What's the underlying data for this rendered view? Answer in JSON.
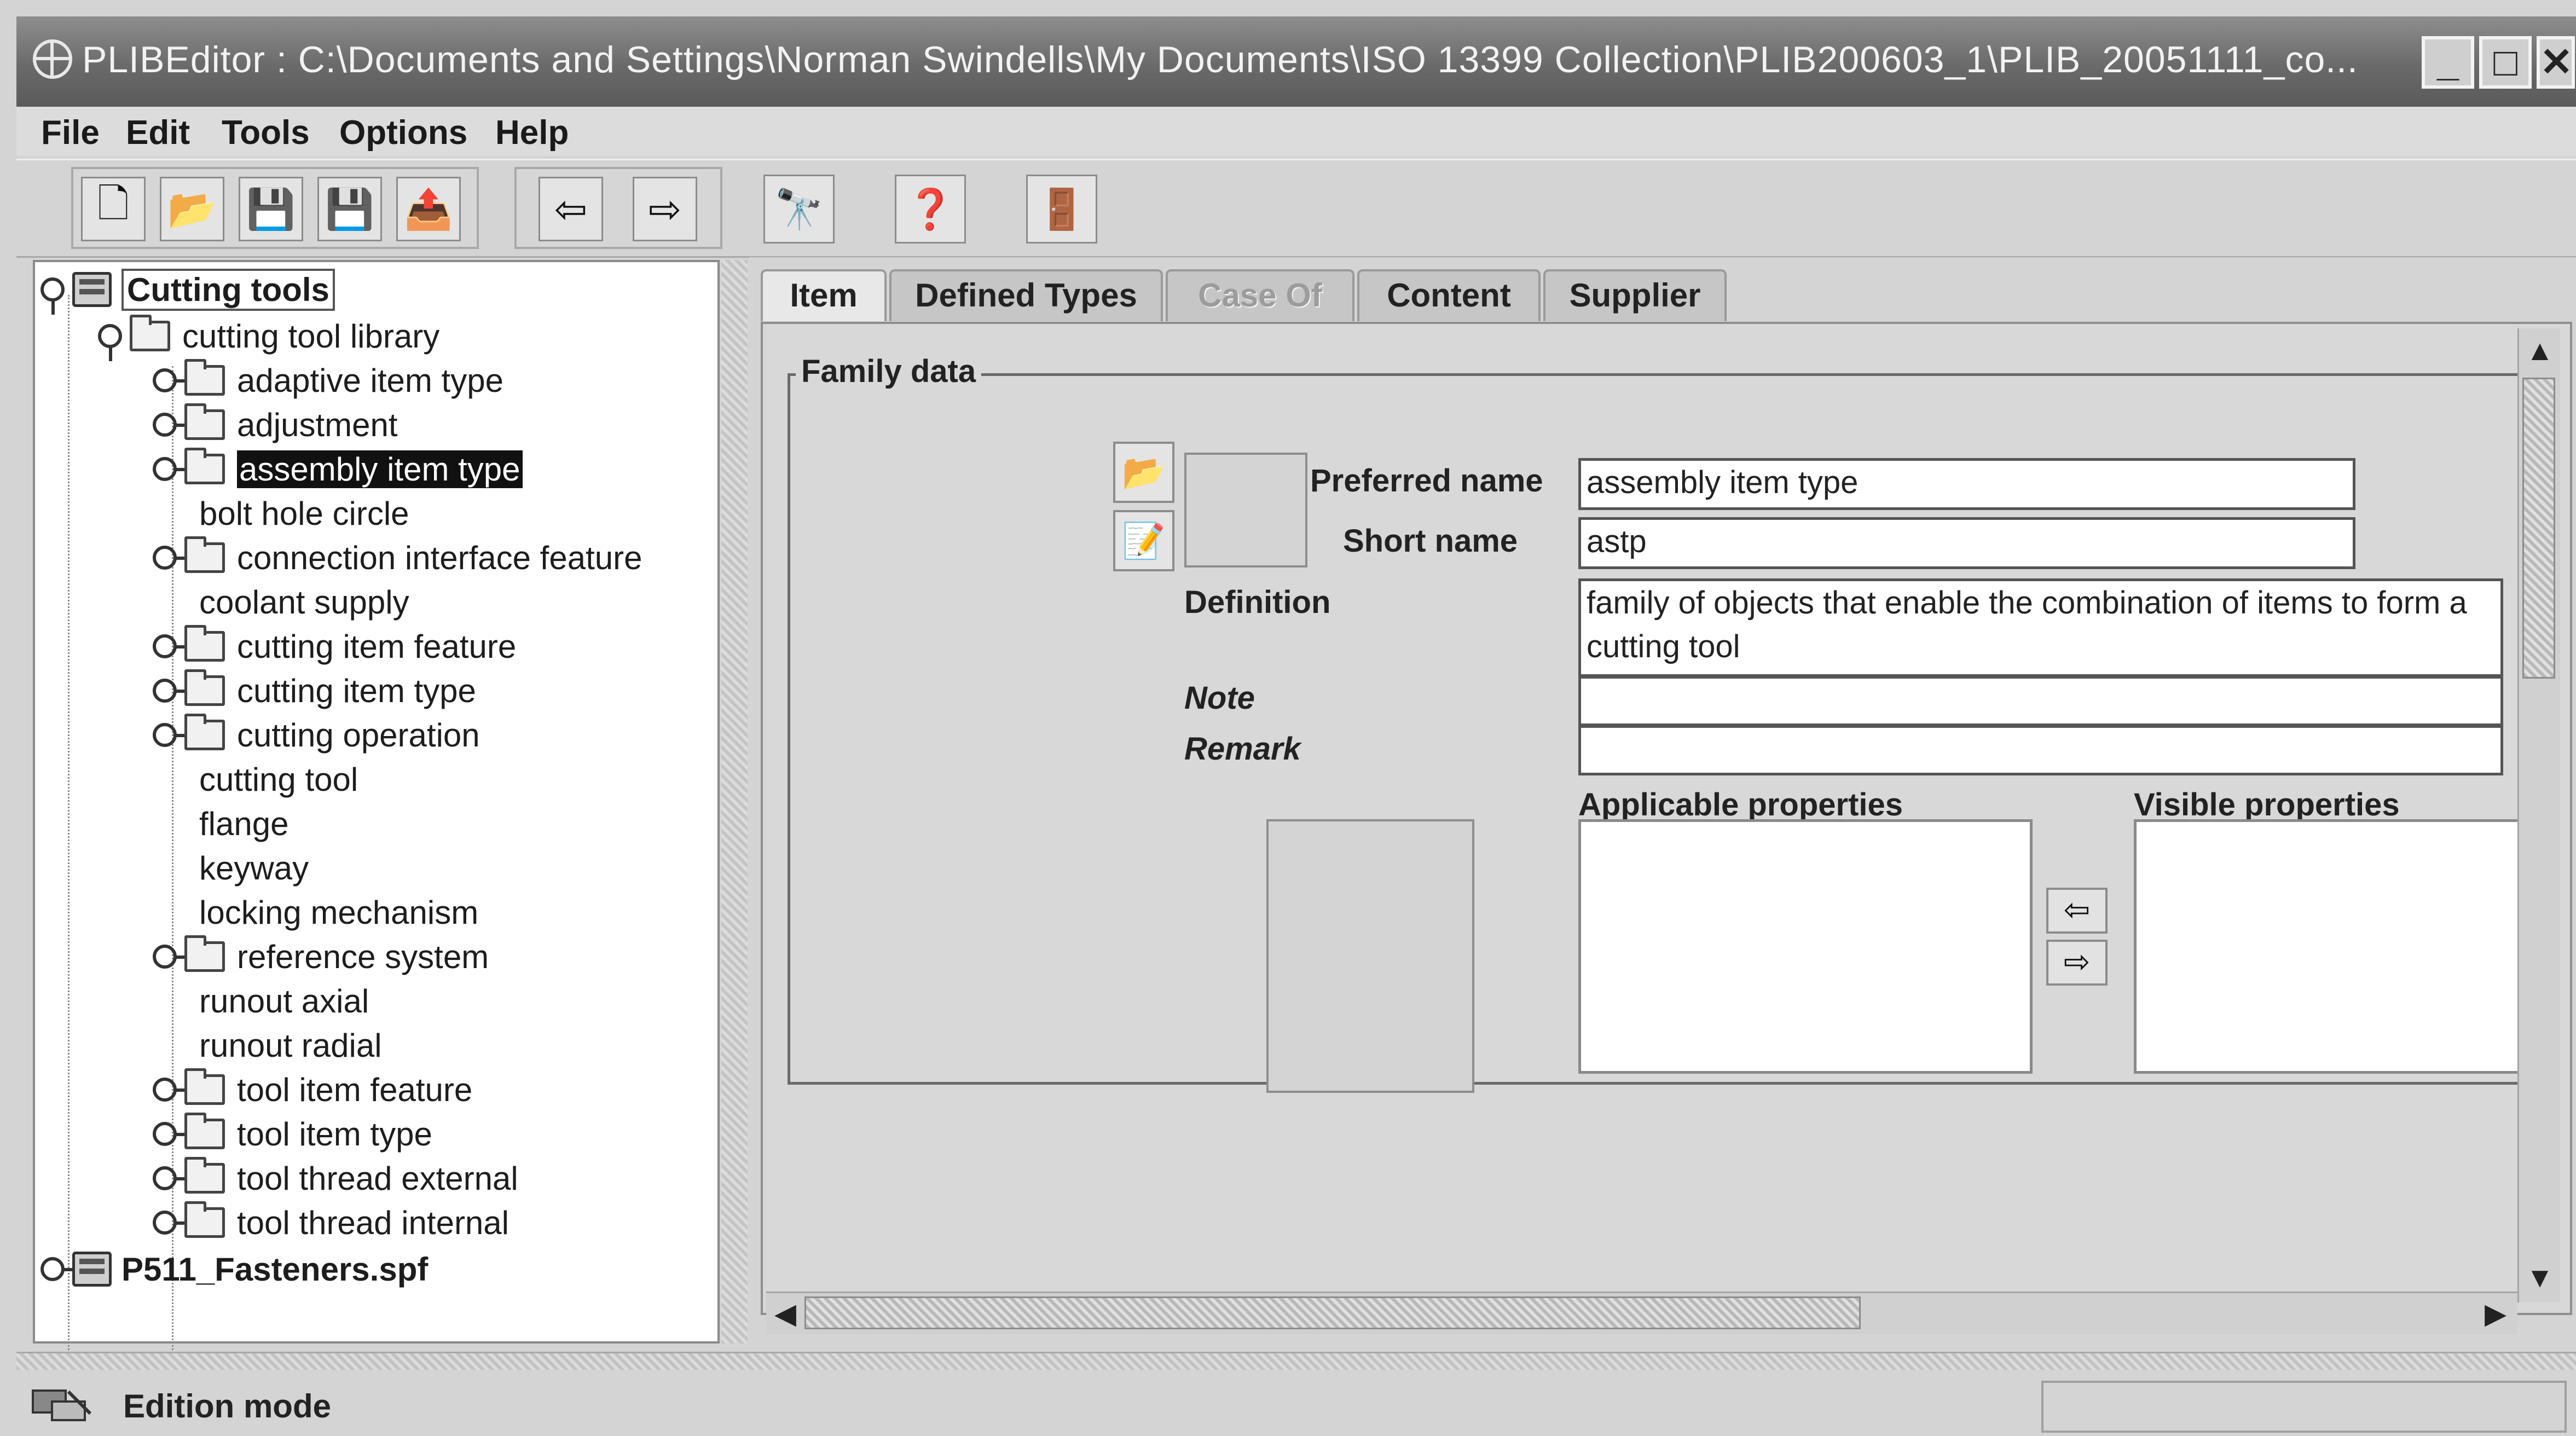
{
  "window": {
    "title": "PLIBEditor : C:\\Documents and Settings\\Norman Swindells\\My Documents\\ISO 13399 Collection\\PLIB200603_1\\PLIB_20051111_co...",
    "minimize_glyph": "_",
    "maximize_glyph": "□",
    "close_glyph": "✕"
  },
  "menu": {
    "items": [
      {
        "label": "File"
      },
      {
        "label": "Edit"
      },
      {
        "label": "Tools"
      },
      {
        "label": "Options"
      },
      {
        "label": "Help"
      }
    ]
  },
  "toolbar": {
    "buttons": [
      {
        "icon": "new-document-icon",
        "glyph": "🗋"
      },
      {
        "icon": "open-folder-icon",
        "glyph": "📂"
      },
      {
        "icon": "save-icon",
        "glyph": "💾"
      },
      {
        "icon": "save-as-icon",
        "glyph": "💾"
      },
      {
        "icon": "export-icon",
        "glyph": "📤"
      },
      {
        "icon": "back-arrow-icon",
        "glyph": "⇦"
      },
      {
        "icon": "forward-arrow-icon",
        "glyph": "⇨"
      },
      {
        "icon": "binoculars-icon",
        "glyph": "🔭"
      },
      {
        "icon": "help-icon",
        "glyph": "❓"
      },
      {
        "icon": "exit-door-icon",
        "glyph": "🚪"
      }
    ]
  },
  "tree": {
    "root": "Cutting tools",
    "library": "cutting tool library",
    "items": [
      {
        "label": "adaptive item type",
        "folder": true
      },
      {
        "label": "adjustment",
        "folder": true
      },
      {
        "label": "assembly item type",
        "folder": true,
        "selected": true
      },
      {
        "label": "bolt hole circle",
        "folder": false
      },
      {
        "label": "connection interface feature",
        "folder": true
      },
      {
        "label": "coolant supply",
        "folder": false
      },
      {
        "label": "cutting item feature",
        "folder": true
      },
      {
        "label": "cutting item type",
        "folder": true
      },
      {
        "label": "cutting operation",
        "folder": true
      },
      {
        "label": "cutting tool",
        "folder": false
      },
      {
        "label": "flange",
        "folder": false
      },
      {
        "label": "keyway",
        "folder": false
      },
      {
        "label": "locking mechanism",
        "folder": false
      },
      {
        "label": "reference system",
        "folder": true
      },
      {
        "label": "runout axial",
        "folder": false
      },
      {
        "label": "runout radial",
        "folder": false
      },
      {
        "label": "tool item feature",
        "folder": true
      },
      {
        "label": "tool item type",
        "folder": true
      },
      {
        "label": "tool thread external",
        "folder": true
      },
      {
        "label": "tool thread internal",
        "folder": true
      }
    ],
    "second_root": "P511_Fasteners.spf"
  },
  "tabs": [
    {
      "label": "Item",
      "active": true
    },
    {
      "label": "Defined Types"
    },
    {
      "label": "Case Of",
      "disabled": true
    },
    {
      "label": "Content"
    },
    {
      "label": "Supplier"
    }
  ],
  "family": {
    "legend": "Family data",
    "preferred_name_label": "Preferred name",
    "preferred_name": "assembly item type",
    "short_name_label": "Short name",
    "short_name": "astp",
    "definition_label": "Definition",
    "definition": "family of objects that enable the combination of items to form a cutting tool",
    "note_label": "Note",
    "note": "",
    "remark_label": "Remark",
    "remark": "",
    "applicable_label": "Applicable properties",
    "visible_label": "Visible properties",
    "move_left_glyph": "⇦",
    "move_right_glyph": "⇨"
  },
  "scroll": {
    "up": "▲",
    "down": "▼",
    "left": "◀",
    "right": "▶"
  },
  "status": {
    "text": "Edition mode"
  }
}
